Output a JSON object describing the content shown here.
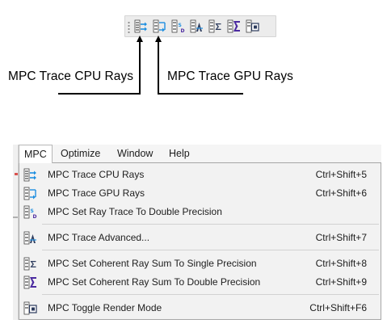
{
  "toolbar": {
    "buttons": [
      {
        "icon": "trace-cpu-rays-icon"
      },
      {
        "icon": "trace-gpu-rays-icon"
      },
      {
        "icon": "double-precision-icon"
      },
      {
        "icon": "trace-advanced-icon"
      },
      {
        "icon": "sum-single-precision-icon"
      },
      {
        "icon": "sum-double-precision-icon"
      },
      {
        "icon": "toggle-render-mode-icon"
      }
    ]
  },
  "callouts": {
    "cpu": "MPC Trace CPU Rays",
    "gpu": "MPC Trace GPU Rays"
  },
  "menubar": {
    "items": [
      "MPC",
      "Optimize",
      "Window",
      "Help"
    ]
  },
  "menu": {
    "items": [
      {
        "label": "MPC Trace CPU Rays",
        "shortcut": "Ctrl+Shift+5",
        "icon": "trace-cpu-rays-icon"
      },
      {
        "label": "MPC Trace GPU Rays",
        "shortcut": "Ctrl+Shift+6",
        "icon": "trace-gpu-rays-icon"
      },
      {
        "label": "MPC Set Ray Trace To Double Precision",
        "shortcut": "",
        "icon": "double-precision-icon"
      },
      {
        "label": "MPC Trace Advanced...",
        "shortcut": "Ctrl+Shift+7",
        "icon": "trace-advanced-icon"
      },
      {
        "label": "MPC Set Coherent Ray Sum To Single Precision",
        "shortcut": "Ctrl+Shift+8",
        "icon": "sum-single-precision-icon"
      },
      {
        "label": "MPC Set Coherent Ray Sum To Double Precision",
        "shortcut": "Ctrl+Shift+9",
        "icon": "sum-double-precision-icon"
      },
      {
        "label": "MPC Toggle Render Mode",
        "shortcut": "Ctrl+Shift+F6",
        "icon": "toggle-render-mode-icon"
      }
    ]
  },
  "colors": {
    "icon_blue": "#1f8fe0",
    "icon_dark": "#2b3a5c",
    "icon_purple": "#4b2aa0"
  }
}
